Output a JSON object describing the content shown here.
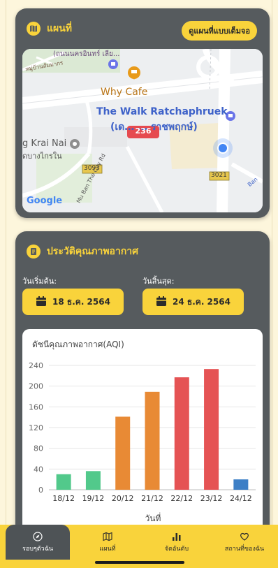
{
  "map_card": {
    "title": "แผนที่",
    "full_button": "ดูแผนที่แบบเต็มจอ",
    "labels": {
      "road_top": "(ถนนนครอินทร์ เลีย...",
      "road_side": "หมู่บ้านสัมมากร",
      "cafe": "Why Cafe",
      "mall_line1": "The Walk Ratchaphruek",
      "mall_line2": "(เด… … ราชพฤกษ์)",
      "aqi_marker": "236",
      "temple_line1": "g Krai Nai",
      "temple_line2": "ดบางไกรใน",
      "road_3093": "3093",
      "road_3021": "3021",
      "road_city": "Mu Ban The City Rd",
      "road_ban": "Ban",
      "google": "Google"
    },
    "colors": {
      "aqi_marker": "#e64a4f",
      "cafe_pin": "#e89a1a",
      "shop_pin": "#6a74e8"
    }
  },
  "air_card": {
    "title": "ประวัติคุณภาพอากาศ",
    "start_label": "วันเริ่มต้น:",
    "end_label": "วันสิ้นสุด:",
    "start_date": "18 ธ.ค. 2564",
    "end_date": "24 ธ.ค. 2564"
  },
  "chart_data": {
    "type": "bar",
    "title": "ดัชนีคุณภาพอากาศ(AQI)",
    "xlabel": "วันที่",
    "ylabel": "",
    "categories": [
      "18/12",
      "19/12",
      "20/12",
      "21/12",
      "22/12",
      "23/12",
      "24/12"
    ],
    "values": [
      30,
      36,
      141,
      189,
      217,
      233,
      20
    ],
    "colors": [
      "#52c98b",
      "#52c98b",
      "#e88a35",
      "#e88a35",
      "#e55354",
      "#e55354",
      "#3d7fc6"
    ],
    "ylim": [
      0,
      240
    ],
    "yticks": [
      0,
      40,
      80,
      120,
      160,
      200,
      240
    ],
    "grid": true
  },
  "nav": {
    "items": [
      {
        "label": "รอบๆตัวฉัน",
        "icon": "compass-icon"
      },
      {
        "label": "แผนที่",
        "icon": "map-icon"
      },
      {
        "label": "จัดอันดับ",
        "icon": "ranking-icon"
      },
      {
        "label": "สถานที่ของฉัน",
        "icon": "heart-icon"
      }
    ]
  }
}
